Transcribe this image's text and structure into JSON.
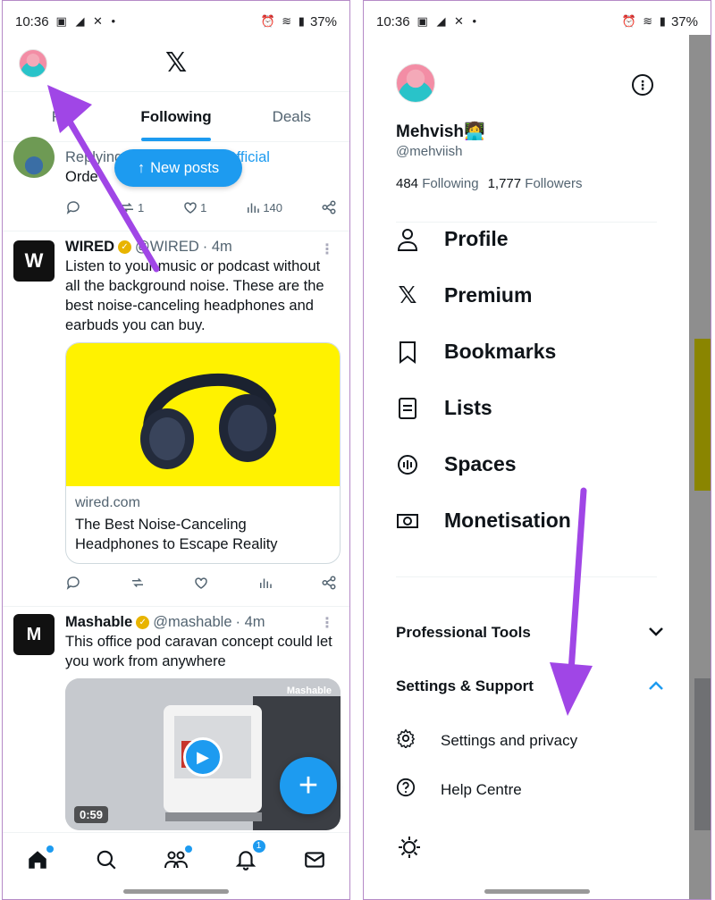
{
  "status_bar": {
    "time": "10:36",
    "battery": "37%"
  },
  "left": {
    "tabs": [
      "For you",
      "Following",
      "Deals"
    ],
    "tab_for_you_visible": "Fo",
    "new_posts": "New posts",
    "reply_post": {
      "line1": "Replying",
      "line1_link": "Official",
      "line2": "Orde",
      "stats": {
        "retweets": "1",
        "likes": "1",
        "views": "140"
      }
    },
    "wired_post": {
      "name": "WIRED",
      "handle": "@WIRED",
      "time": "· 4m",
      "text": "Listen to your music or podcast without all the background noise. These are the best noise-canceling headphones and earbuds you can buy.",
      "card_domain": "wired.com",
      "card_title": "The Best Noise-Canceling Headphones to Escape Reality",
      "card_bg": "#fff200"
    },
    "mashable_post": {
      "name": "Mashable",
      "handle": "@mashable",
      "time": "· 4m",
      "text": "This office pod caravan concept could let you work from anywhere",
      "video_duration": "0:59",
      "watermark": "Mashable"
    },
    "notification_badge": "1"
  },
  "right": {
    "user": {
      "name": "Mehvish",
      "emoji": "👩‍💻",
      "handle": "@mehviish",
      "following_count": "484",
      "following_label": "Following",
      "followers_count": "1,777",
      "followers_label": "Followers"
    },
    "menu": [
      {
        "label": "Profile",
        "icon": "person-icon"
      },
      {
        "label": "Premium",
        "icon": "x-logo-icon"
      },
      {
        "label": "Bookmarks",
        "icon": "bookmark-icon"
      },
      {
        "label": "Lists",
        "icon": "list-icon"
      },
      {
        "label": "Spaces",
        "icon": "spaces-icon"
      },
      {
        "label": "Monetisation",
        "icon": "money-icon"
      }
    ],
    "sections": {
      "professional_tools": "Professional Tools",
      "settings_support": "Settings & Support"
    },
    "subitems": [
      {
        "label": "Settings and privacy",
        "icon": "gear-icon"
      },
      {
        "label": "Help Centre",
        "icon": "help-icon"
      }
    ]
  },
  "colors": {
    "accent": "#1d9bf0",
    "arrow": "#a046e6"
  }
}
